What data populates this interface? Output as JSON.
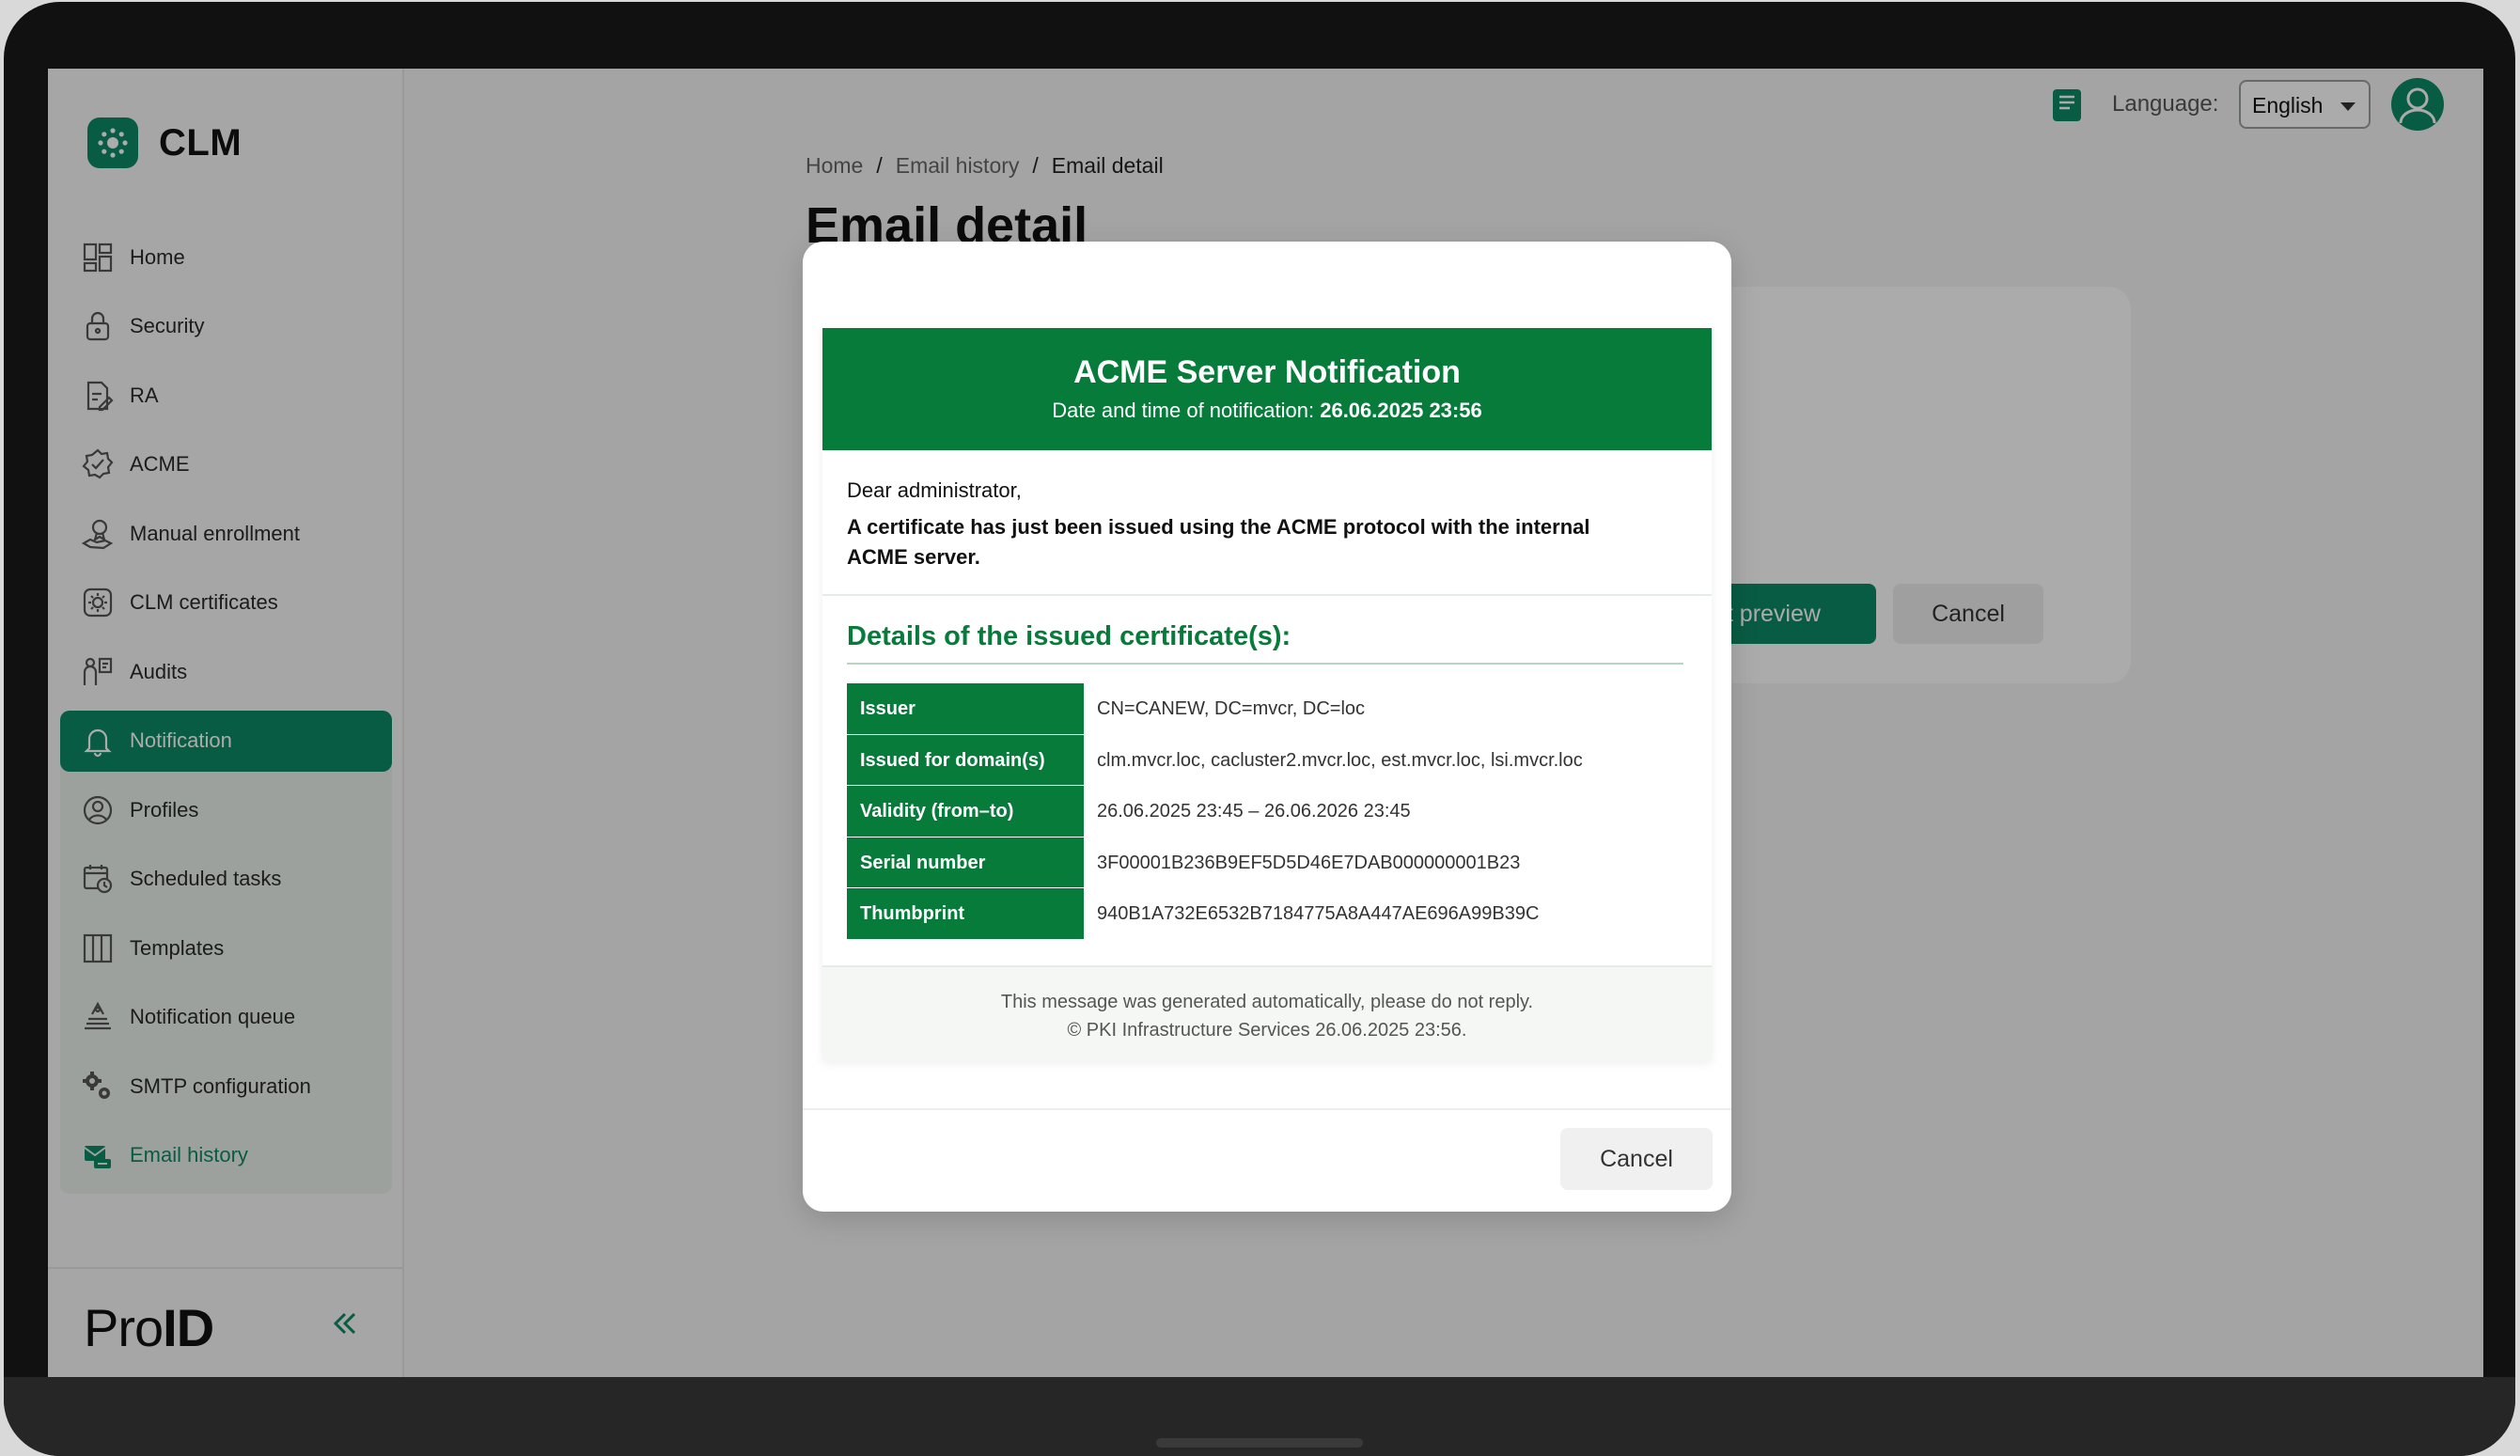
{
  "app": {
    "name": "CLM",
    "vendor": "Pro",
    "vendor_bold": "ID"
  },
  "sidebar": {
    "items": [
      {
        "label": "Home",
        "icon": "dashboard-icon"
      },
      {
        "label": "Security",
        "icon": "lock-icon"
      },
      {
        "label": "RA",
        "icon": "document-edit-icon"
      },
      {
        "label": "ACME",
        "icon": "badge-check-icon"
      },
      {
        "label": "Manual enrollment",
        "icon": "hand-certificate-icon"
      },
      {
        "label": "CLM certificates",
        "icon": "certificate-gear-icon"
      },
      {
        "label": "Audits",
        "icon": "audit-icon"
      },
      {
        "label": "Notification",
        "icon": "bell-icon"
      },
      {
        "label": "Profiles",
        "icon": "user-circle-icon"
      },
      {
        "label": "Scheduled tasks",
        "icon": "calendar-clock-icon"
      },
      {
        "label": "Templates",
        "icon": "columns-icon"
      },
      {
        "label": "Notification queue",
        "icon": "stack-icon"
      },
      {
        "label": "SMTP configuration",
        "icon": "gears-icon"
      },
      {
        "label": "Email history",
        "icon": "email-history-icon"
      }
    ]
  },
  "topbar": {
    "language_label": "Language:",
    "language_value": "English"
  },
  "breadcrumb": {
    "home": "Home",
    "sep": "/",
    "email_history": "Email history",
    "current": "Email detail"
  },
  "page": {
    "title": "Email detail",
    "preview_button": "nt preview",
    "cancel_button": "Cancel"
  },
  "modal": {
    "header_title": "ACME Server Notification",
    "header_date_label": "Date and time of notification:",
    "header_date_value": "26.06.2025 23:56",
    "greeting": "Dear administrator,",
    "intro": "A certificate has just been issued using the ACME protocol with the internal ACME server.",
    "details_title": "Details of the issued certificate(s):",
    "rows": [
      {
        "key": "Issuer",
        "value": "CN=CANEW, DC=mvcr, DC=loc"
      },
      {
        "key": "Issued for domain(s)",
        "value": "clm.mvcr.loc, cacluster2.mvcr.loc, est.mvcr.loc, lsi.mvcr.loc"
      },
      {
        "key": "Validity (from–to)",
        "value": "26.06.2025 23:45 – 26.06.2026 23:45"
      },
      {
        "key": "Serial number",
        "value": "3F00001B236B9EF5D5D46E7DAB000000001B23"
      },
      {
        "key": "Thumbprint",
        "value": "940B1A732E6532B7184775A8A447AE696A99B39C"
      }
    ],
    "footer_line1": "This message was generated automatically, please do not reply.",
    "footer_line2": "© PKI Infrastructure Services 26.06.2025 23:56.",
    "cancel_button": "Cancel"
  },
  "colors": {
    "brand": "#0e8a66",
    "mail_green": "#067b3a"
  }
}
